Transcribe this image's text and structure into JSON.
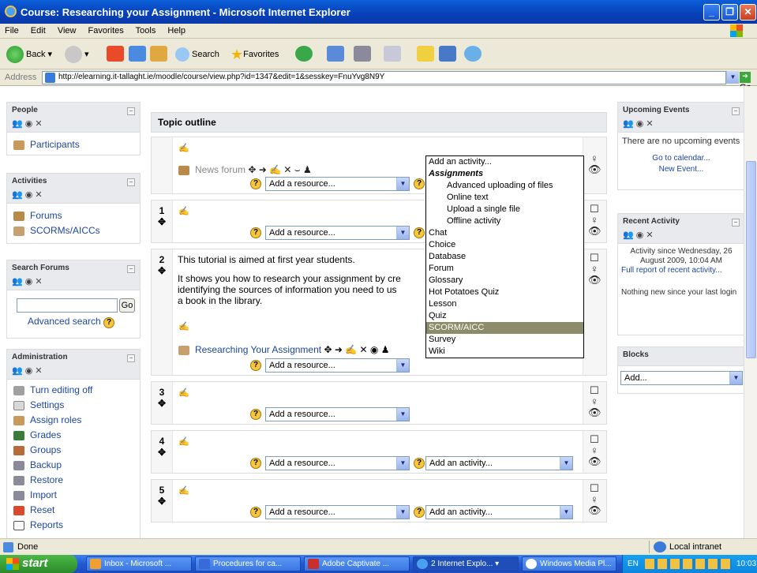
{
  "window": {
    "title": "Course: Researching your Assignment - Microsoft Internet Explorer"
  },
  "menu": [
    "File",
    "Edit",
    "View",
    "Favorites",
    "Tools",
    "Help"
  ],
  "toolbar": {
    "back": "Back",
    "search": "Search",
    "favorites": "Favorites"
  },
  "address": {
    "label": "Address",
    "url": "http://elearning.it-tallaght.ie/moodle/course/view.php?id=1347&edit=1&sesskey=FnuYvg8N9Y",
    "go": "Go"
  },
  "left": {
    "people": {
      "title": "People",
      "items": [
        "Participants"
      ]
    },
    "activities": {
      "title": "Activities",
      "items": [
        "Forums",
        "SCORMs/AICCs"
      ]
    },
    "search": {
      "title": "Search Forums",
      "go": "Go",
      "advanced": "Advanced search"
    },
    "admin": {
      "title": "Administration",
      "items": [
        "Turn editing off",
        "Settings",
        "Assign roles",
        "Grades",
        "Groups",
        "Backup",
        "Restore",
        "Import",
        "Reset",
        "Reports"
      ]
    }
  },
  "course": {
    "heading": "Topic outline",
    "news_forum": "News forum",
    "add_resource": "Add a resource...",
    "add_activity": "Add an activity...",
    "section_numbers": [
      "1",
      "2",
      "3",
      "4",
      "5"
    ],
    "s2_text1": "This tutorial is aimed at first year students.",
    "s2_text2a": "It shows you how to research your assignment by cre",
    "s2_text2b": "identifying the sources of information you need to us",
    "s2_text2c": "a book in the library.",
    "s2_link": "Researching Your Assignment"
  },
  "dropdown": {
    "first": "Add an activity...",
    "group": "Assignments",
    "sub": [
      "Advanced uploading of files",
      "Online text",
      "Upload a single file",
      "Offline activity"
    ],
    "items": [
      "Chat",
      "Choice",
      "Database",
      "Forum",
      "Glossary",
      "Hot Potatoes Quiz",
      "Lesson",
      "Quiz",
      "SCORM/AICC",
      "Survey",
      "Wiki"
    ],
    "selected": "SCORM/AICC"
  },
  "right": {
    "events": {
      "title": "Upcoming Events",
      "text": "There are no upcoming events",
      "link1": "Go to calendar...",
      "link2": "New Event..."
    },
    "recent": {
      "title": "Recent Activity",
      "since": "Activity since Wednesday, 26 August 2009, 10:04 AM",
      "full": "Full report of recent activity...",
      "nothing": "Nothing new since your last login"
    },
    "blocks": {
      "title": "Blocks",
      "select": "Add..."
    }
  },
  "status": {
    "left": "Done",
    "zone": "Local intranet"
  },
  "taskbar": {
    "start": "start",
    "tasks": [
      "Inbox - Microsoft ...",
      "Procedures for ca...",
      "Adobe Captivate ...",
      "2 Internet Explo...",
      "Windows Media Pl..."
    ],
    "lang": "EN",
    "clock": "10:03"
  }
}
